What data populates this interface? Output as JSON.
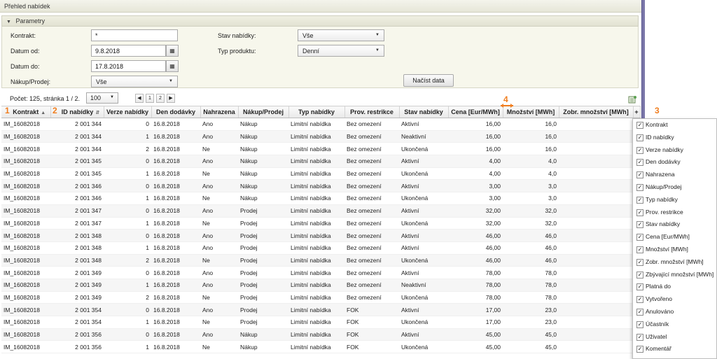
{
  "window": {
    "title": "Přehled nabídek"
  },
  "params": {
    "header": "Parametry",
    "kontrakt_label": "Kontrakt:",
    "kontrakt_value": "*",
    "datum_od_label": "Datum od:",
    "datum_od_value": "9.8.2018",
    "datum_do_label": "Datum do:",
    "datum_do_value": "17.8.2018",
    "nakup_prodej_label": "Nákup/Prodej:",
    "nakup_prodej_value": "Vše",
    "stav_label": "Stav nabídky:",
    "stav_value": "Vše",
    "typ_label": "Typ produktu:",
    "typ_value": "Denní",
    "load_button": "Načíst data"
  },
  "paging": {
    "count_text": "Počet: 125, stránka 1 / 2.",
    "page_size": "100",
    "pages": [
      "1",
      "2"
    ]
  },
  "markers": [
    "1",
    "2",
    "3",
    "4"
  ],
  "grid": {
    "columns": [
      "Kontrakt",
      "ID nabídky",
      "Verze nabídky",
      "Den dodávky",
      "Nahrazena",
      "Nákup/Prodej",
      "Typ nabídky",
      "Prov. restrikce",
      "Stav nabídky",
      "Cena [Eur/MWh]",
      "Množství [MWh]",
      "Zobr. množství [MWh]",
      "+"
    ],
    "rows": [
      [
        "IM_16082018",
        "2 001 344",
        "0",
        "16.8.2018",
        "Ano",
        "Nákup",
        "Limitní nabídka",
        "Bez omezení",
        "Aktivní",
        "16,00",
        "16,0",
        ""
      ],
      [
        "IM_16082018",
        "2 001 344",
        "1",
        "16.8.2018",
        "Ano",
        "Nákup",
        "Limitní nabídka",
        "Bez omezení",
        "Neaktivní",
        "16,00",
        "16,0",
        ""
      ],
      [
        "IM_16082018",
        "2 001 344",
        "2",
        "16.8.2018",
        "Ne",
        "Nákup",
        "Limitní nabídka",
        "Bez omezení",
        "Ukončená",
        "16,00",
        "16,0",
        ""
      ],
      [
        "IM_16082018",
        "2 001 345",
        "0",
        "16.8.2018",
        "Ano",
        "Nákup",
        "Limitní nabídka",
        "Bez omezení",
        "Aktivní",
        "4,00",
        "4,0",
        ""
      ],
      [
        "IM_16082018",
        "2 001 345",
        "1",
        "16.8.2018",
        "Ne",
        "Nákup",
        "Limitní nabídka",
        "Bez omezení",
        "Ukončená",
        "4,00",
        "4,0",
        ""
      ],
      [
        "IM_16082018",
        "2 001 346",
        "0",
        "16.8.2018",
        "Ano",
        "Nákup",
        "Limitní nabídka",
        "Bez omezení",
        "Aktivní",
        "3,00",
        "3,0",
        ""
      ],
      [
        "IM_16082018",
        "2 001 346",
        "1",
        "16.8.2018",
        "Ne",
        "Nákup",
        "Limitní nabídka",
        "Bez omezení",
        "Ukončená",
        "3,00",
        "3,0",
        ""
      ],
      [
        "IM_16082018",
        "2 001 347",
        "0",
        "16.8.2018",
        "Ano",
        "Prodej",
        "Limitní nabídka",
        "Bez omezení",
        "Aktivní",
        "32,00",
        "32,0",
        ""
      ],
      [
        "IM_16082018",
        "2 001 347",
        "1",
        "16.8.2018",
        "Ne",
        "Prodej",
        "Limitní nabídka",
        "Bez omezení",
        "Ukončená",
        "32,00",
        "32,0",
        ""
      ],
      [
        "IM_16082018",
        "2 001 348",
        "0",
        "16.8.2018",
        "Ano",
        "Prodej",
        "Limitní nabídka",
        "Bez omezení",
        "Aktivní",
        "46,00",
        "46,0",
        ""
      ],
      [
        "IM_16082018",
        "2 001 348",
        "1",
        "16.8.2018",
        "Ano",
        "Prodej",
        "Limitní nabídka",
        "Bez omezení",
        "Aktivní",
        "46,00",
        "46,0",
        ""
      ],
      [
        "IM_16082018",
        "2 001 348",
        "2",
        "16.8.2018",
        "Ne",
        "Prodej",
        "Limitní nabídka",
        "Bez omezení",
        "Ukončená",
        "46,00",
        "46,0",
        ""
      ],
      [
        "IM_16082018",
        "2 001 349",
        "0",
        "16.8.2018",
        "Ano",
        "Prodej",
        "Limitní nabídka",
        "Bez omezení",
        "Aktivní",
        "78,00",
        "78,0",
        ""
      ],
      [
        "IM_16082018",
        "2 001 349",
        "1",
        "16.8.2018",
        "Ano",
        "Prodej",
        "Limitní nabídka",
        "Bez omezení",
        "Neaktivní",
        "78,00",
        "78,0",
        ""
      ],
      [
        "IM_16082018",
        "2 001 349",
        "2",
        "16.8.2018",
        "Ne",
        "Prodej",
        "Limitní nabídka",
        "Bez omezení",
        "Ukončená",
        "78,00",
        "78,0",
        ""
      ],
      [
        "IM_16082018",
        "2 001 354",
        "0",
        "16.8.2018",
        "Ano",
        "Prodej",
        "Limitní nabídka",
        "FOK",
        "Aktivní",
        "17,00",
        "23,0",
        ""
      ],
      [
        "IM_16082018",
        "2 001 354",
        "1",
        "16.8.2018",
        "Ne",
        "Prodej",
        "Limitní nabídka",
        "FOK",
        "Ukončená",
        "17,00",
        "23,0",
        ""
      ],
      [
        "IM_16082018",
        "2 001 356",
        "0",
        "16.8.2018",
        "Ano",
        "Nákup",
        "Limitní nabídka",
        "FOK",
        "Aktivní",
        "45,00",
        "45,0",
        ""
      ],
      [
        "IM_16082018",
        "2 001 356",
        "1",
        "16.8.2018",
        "Ne",
        "Nákup",
        "Limitní nabídka",
        "FOK",
        "Ukončená",
        "45,00",
        "45,0",
        ""
      ]
    ]
  },
  "column_chooser": {
    "items": [
      "Kontrakt",
      "ID nabídky",
      "Verze nabídky",
      "Den dodávky",
      "Nahrazena",
      "Nákup/Prodej",
      "Typ nabídky",
      "Prov. restrikce",
      "Stav nabídky",
      "Cena [Eur/MWh]",
      "Množství [MWh]",
      "Zobr. množství [MWh]",
      "Zbývající množství [MWh]",
      "Platná do",
      "Vytvořeno",
      "Anulováno",
      "Účastník",
      "Uživatel",
      "Komentář"
    ],
    "check_glyph": "✓"
  },
  "colors": {
    "marker": "#f07d1e",
    "header_bg": "#efefe2",
    "params_bg": "#f7f7ec"
  }
}
